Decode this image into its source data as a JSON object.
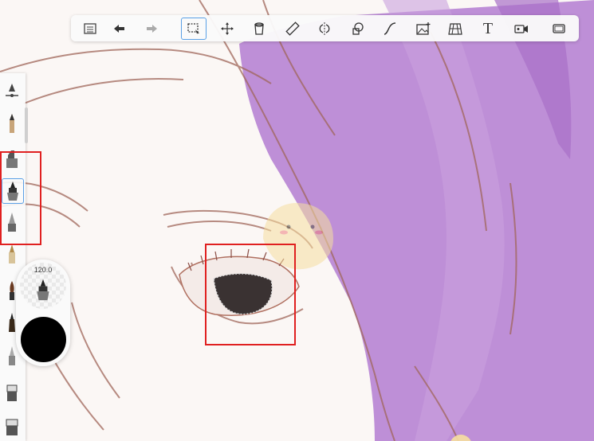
{
  "toolbar": {
    "items": [
      {
        "name": "list-icon"
      },
      {
        "name": "undo-icon"
      },
      {
        "name": "redo-icon"
      },
      {
        "name": "selection-icon",
        "active": true
      },
      {
        "name": "transform-icon"
      },
      {
        "name": "fill-icon"
      },
      {
        "name": "ruler-icon"
      },
      {
        "name": "symmetry-icon"
      },
      {
        "name": "shape-icon"
      },
      {
        "name": "curve-icon"
      },
      {
        "name": "add-image-icon"
      },
      {
        "name": "perspective-icon"
      },
      {
        "name": "text-icon",
        "label": "T"
      },
      {
        "name": "record-icon"
      },
      {
        "name": "fullscreen-icon"
      }
    ]
  },
  "brush_panel": {
    "brushes": [
      "pencil",
      "marker",
      "ink-pen",
      "airbrush",
      "calligraphy-pen",
      "paint-brush",
      "fine-pen",
      "soft-brush",
      "eraser",
      "eraser-wide"
    ],
    "selected": "ink-pen"
  },
  "brush_puck": {
    "size_value": "120.0",
    "current_color": "#000000"
  },
  "colors": {
    "hair_purple": "#b985d4",
    "highlight_red": "#e02020",
    "selection_accent": "#5aa0e6"
  }
}
